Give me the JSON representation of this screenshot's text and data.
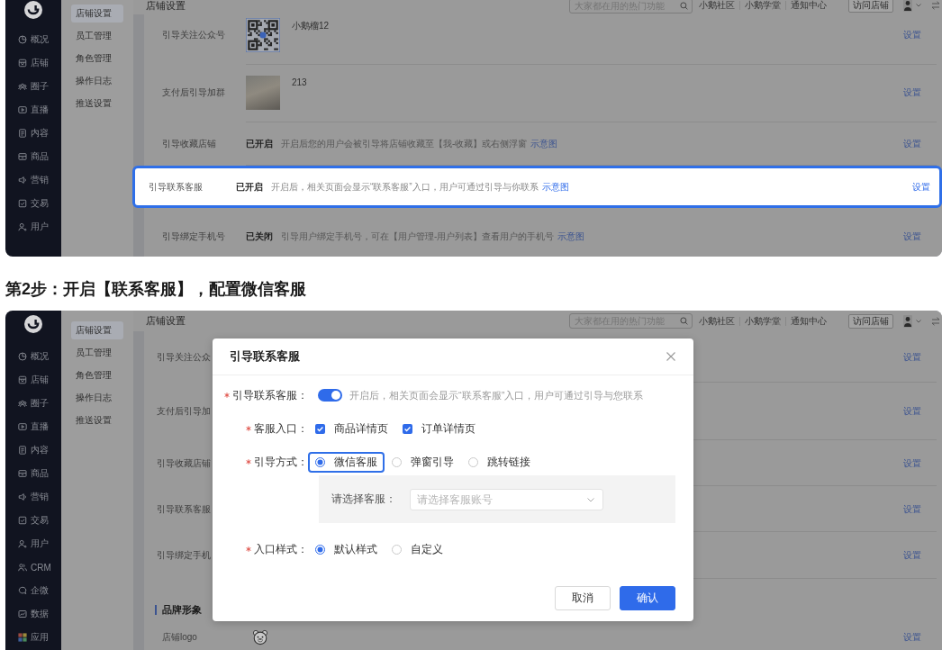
{
  "screenshot_top": {
    "sidebar": {
      "items": [
        "概况",
        "店铺",
        "圈子",
        "直播",
        "内容",
        "商品",
        "营销",
        "交易",
        "用户"
      ]
    },
    "submenu": [
      {
        "label": "店铺设置",
        "selected": true
      },
      {
        "label": "员工管理",
        "selected": false
      },
      {
        "label": "角色管理",
        "selected": false
      },
      {
        "label": "操作日志",
        "selected": false
      },
      {
        "label": "推送设置",
        "selected": false
      }
    ],
    "page_title": "店铺设置",
    "topbar": {
      "search": {
        "placeholder": "大家都在用的热门功能"
      },
      "links": [
        "小鹅社区",
        "小鹅学堂",
        "通知中心"
      ],
      "visit_button": "访问店铺"
    },
    "rows": [
      {
        "kind": "qr",
        "label": "引导关注公众号",
        "caption": "小鹅榴12",
        "action": "设置",
        "highlighted": false
      },
      {
        "kind": "photo",
        "label": "支付后引导加群",
        "caption": "213",
        "action": "设置",
        "highlighted": false
      },
      {
        "kind": "status",
        "label": "引导收藏店铺",
        "status": "已开启",
        "description": "开启后您的用户会被引导将店铺收藏至【我-收藏】或右侧浮窗",
        "link": "示意图",
        "action": "设置",
        "highlighted": false
      },
      {
        "kind": "status",
        "label": "引导联系客服",
        "status": "已开启",
        "description": "开启后，相关页面会显示“联系客服”入口，用户可通过引导与你联系",
        "link": "示意图",
        "action": "设置",
        "highlighted": true
      },
      {
        "kind": "status",
        "label": "引导绑定手机号",
        "status": "已关闭",
        "description": "引导用户绑定手机号，可在【用户管理-用户列表】查看用户的手机号",
        "link": "示意图",
        "action": "设置",
        "highlighted": false
      }
    ]
  },
  "step_heading": "第2步：开启【联系客服】，配置微信客服",
  "screenshot_bottom": {
    "sidebar": {
      "items": [
        "概况",
        "店铺",
        "圈子",
        "直播",
        "内容",
        "商品",
        "营销",
        "交易",
        "用户",
        "CRM",
        "企微",
        "数据",
        "应用"
      ]
    },
    "submenu": [
      {
        "label": "店铺设置",
        "selected": true
      },
      {
        "label": "员工管理",
        "selected": false
      },
      {
        "label": "角色管理",
        "selected": false
      },
      {
        "label": "操作日志",
        "selected": false
      },
      {
        "label": "推送设置",
        "selected": false
      }
    ],
    "page_title": "店铺设置",
    "topbar": {
      "search": {
        "placeholder": "大家都在用的热门功能"
      },
      "links": [
        "小鹅社区",
        "小鹅学堂",
        "通知中心"
      ],
      "visit_button": "访问店铺"
    },
    "rows": [
      {
        "kind": "plain",
        "label": "引导关注公众",
        "action": "设置",
        "highlighted": false
      },
      {
        "kind": "plain",
        "label": "支付后引导加",
        "action": "设置",
        "highlighted": false
      },
      {
        "kind": "plain",
        "label": "引导收藏店铺",
        "action": "设置",
        "highlighted": false
      },
      {
        "kind": "plain",
        "label": "引导联系客服",
        "action": "设置",
        "highlighted": false
      },
      {
        "kind": "plain",
        "label": "引导绑定手机",
        "action": "设置",
        "highlighted": false
      },
      {
        "kind": "section",
        "title": "品牌形象"
      },
      {
        "kind": "logo",
        "label": "店铺logo",
        "action": "设置"
      }
    ],
    "modal": {
      "title": "引导联系客服",
      "fields": [
        {
          "kind": "switch",
          "label": "引导联系客服：",
          "required": true,
          "on": true,
          "hint": "开启后，相关页面会显示“联系客服”入口，用户可通过引导与您联系"
        },
        {
          "kind": "checkboxes",
          "label": "客服入口：",
          "required": true,
          "options": [
            {
              "label": "商品详情页",
              "checked": true
            },
            {
              "label": "订单详情页",
              "checked": true
            }
          ]
        },
        {
          "kind": "radios",
          "label": "引导方式：",
          "required": true,
          "options": [
            {
              "label": "微信客服",
              "selected": true,
              "highlighted": true
            },
            {
              "label": "弹窗引导",
              "selected": false,
              "highlighted": false
            },
            {
              "label": "跳转链接",
              "selected": false,
              "highlighted": false
            }
          ],
          "sub": {
            "label": "请选择客服：",
            "select": {
              "placeholder": "请选择客服账号"
            }
          }
        },
        {
          "kind": "radios",
          "label": "入口样式：",
          "required": true,
          "options": [
            {
              "label": "默认样式",
              "selected": true,
              "highlighted": false
            },
            {
              "label": "自定义",
              "selected": false,
              "highlighted": false
            }
          ]
        }
      ],
      "buttons": [
        {
          "label": "取消",
          "kind": "secondary"
        },
        {
          "label": "确认",
          "kind": "primary"
        }
      ]
    }
  }
}
